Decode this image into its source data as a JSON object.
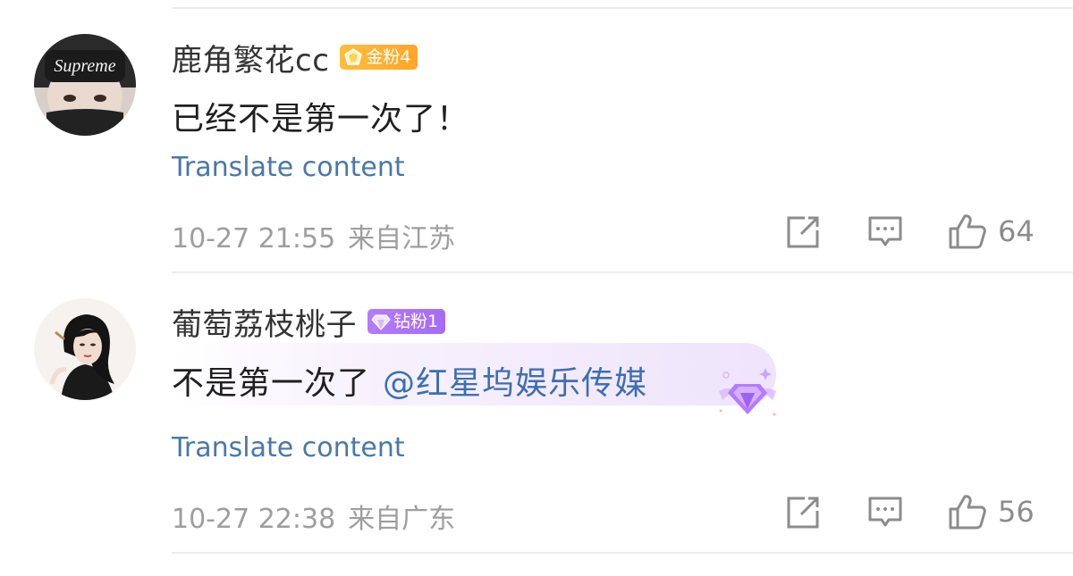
{
  "comments": [
    {
      "username": "鹿角繁花cc",
      "badge": "金粉4",
      "badge_color": "#FFB02E",
      "body": "已经不是第一次了！",
      "mention": "",
      "translate": "Translate content",
      "date": "10-27 21:55",
      "location": "来自江苏",
      "likes": "64"
    },
    {
      "username": "葡萄荔枝桃子",
      "badge": "钻粉1",
      "badge_color": "#A96EF8",
      "body": "不是第一次了",
      "mention": "@红星坞娱乐传媒",
      "translate": "Translate content",
      "date": "10-27 22:38",
      "location": "来自广东",
      "likes": "56"
    }
  ],
  "icons": {
    "share": "share-icon",
    "comment": "comment-icon",
    "like": "like-icon"
  }
}
